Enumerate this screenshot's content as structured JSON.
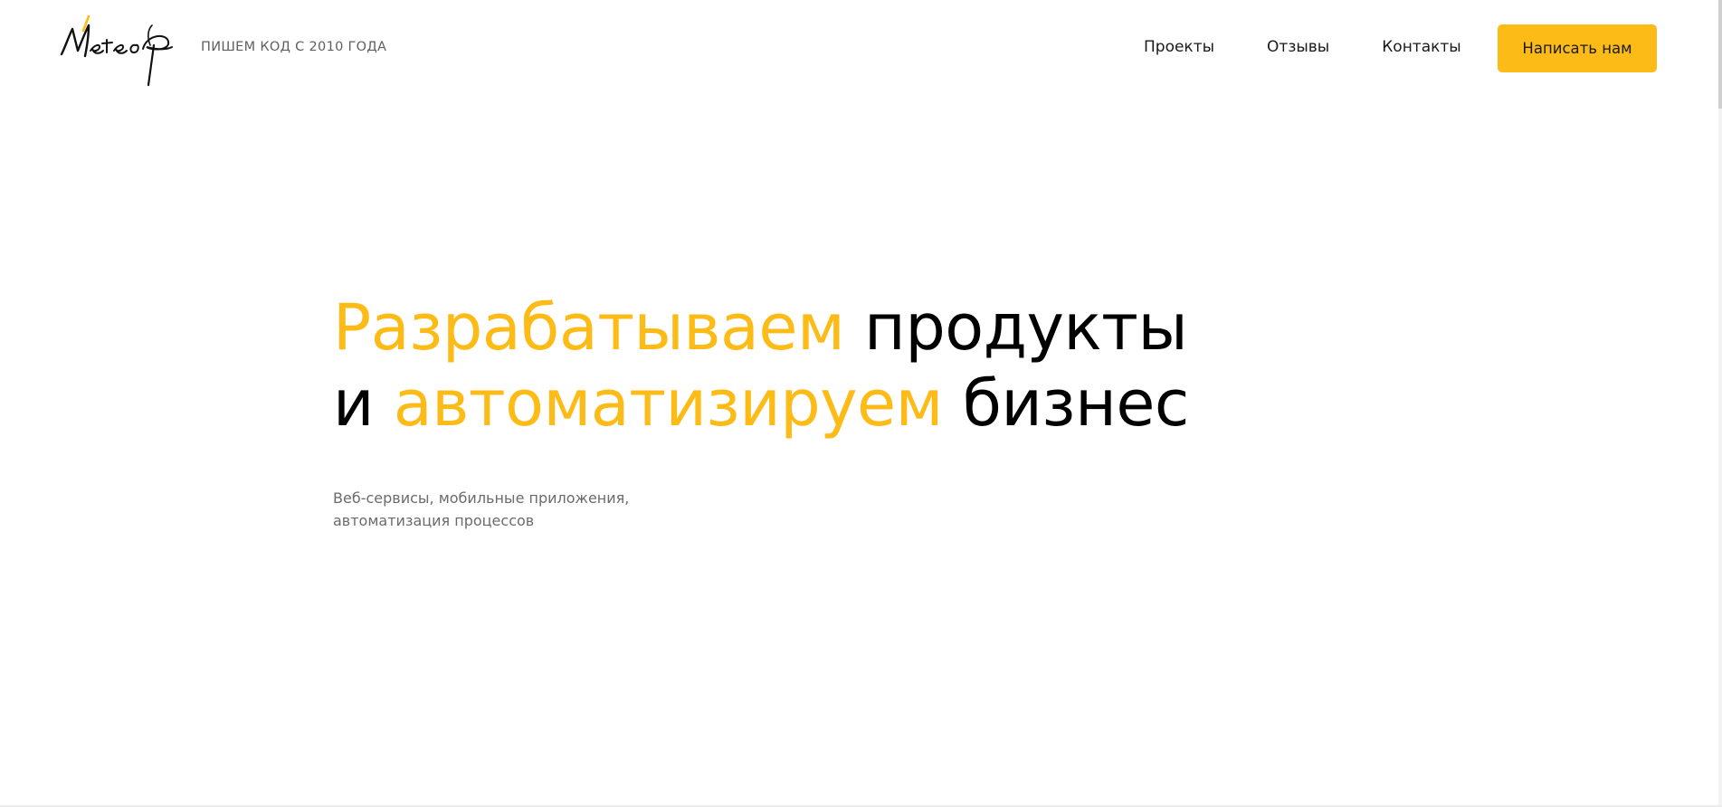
{
  "header": {
    "logo_text": "Метеор",
    "tagline": "ПИШЕМ КОД С 2010 ГОДА",
    "nav": [
      {
        "label": "Проекты"
      },
      {
        "label": "Отзывы"
      },
      {
        "label": "Контакты"
      }
    ],
    "cta_label": "Написать нам"
  },
  "hero": {
    "line1_highlight": "Разрабатываем",
    "line1_rest": " продукты",
    "line2_start": "и ",
    "line2_highlight": "автоматизируем",
    "line2_rest": " бизнес",
    "sub_line1": "Веб-сервисы, мобильные приложения,",
    "sub_line2": "автоматизация процессов"
  },
  "colors": {
    "accent": "#fdbb17",
    "text": "#000000",
    "muted": "#6b6b6b",
    "background": "#ffffff"
  },
  "icons": {
    "logo": "meteor-logo-icon"
  }
}
